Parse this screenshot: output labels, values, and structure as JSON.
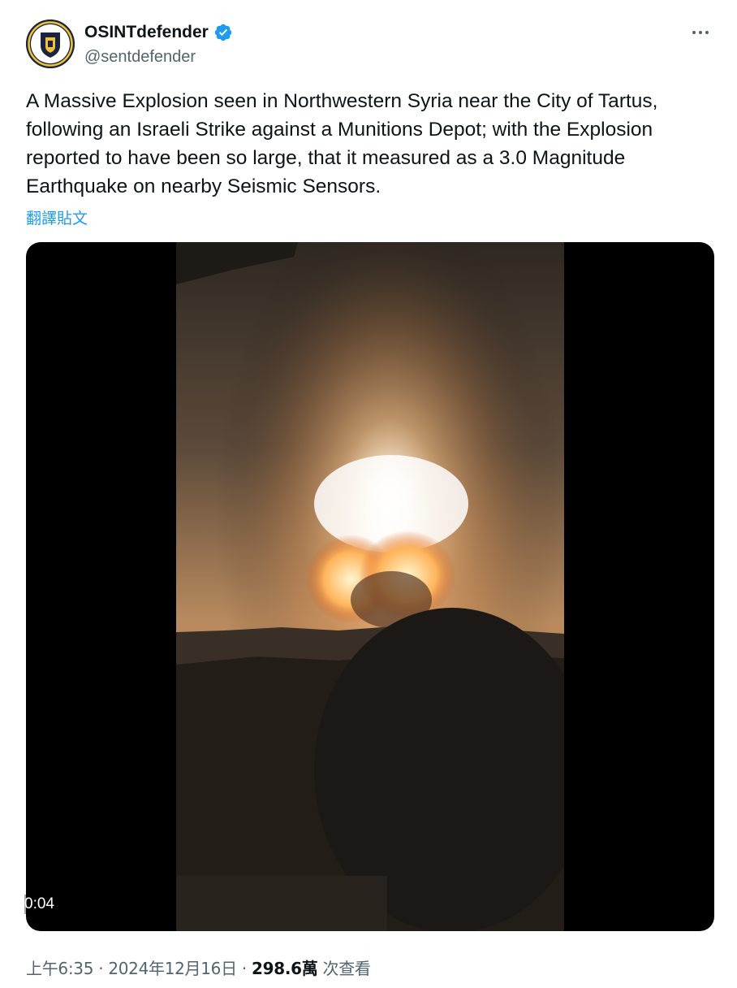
{
  "author": {
    "display_name": "OSINTdefender",
    "handle": "@sentdefender",
    "verified": true,
    "avatar_icon": "osint-shield-logo-icon"
  },
  "more_icon": "more-horizontal-icon",
  "tweet": {
    "text": "A Massive Explosion seen in Northwestern Syria near the City of Tartus, following an Israeli Strike against a Munitions Depot; with the Explosion reported to have been so large, that it measured as a 3.0 Magnitude Earthquake on nearby Seismic Sensors.",
    "translate_label": "翻譯貼文"
  },
  "media": {
    "type": "video",
    "time_label": "0:04"
  },
  "meta": {
    "time": "上午6:35",
    "separator": "·",
    "date": "2024年12月16日",
    "views": "298.6萬",
    "views_suffix": "次查看"
  },
  "colors": {
    "link": "#1d9bf0",
    "verified_badge": "#1d9bf0",
    "secondary_text": "#536471"
  }
}
